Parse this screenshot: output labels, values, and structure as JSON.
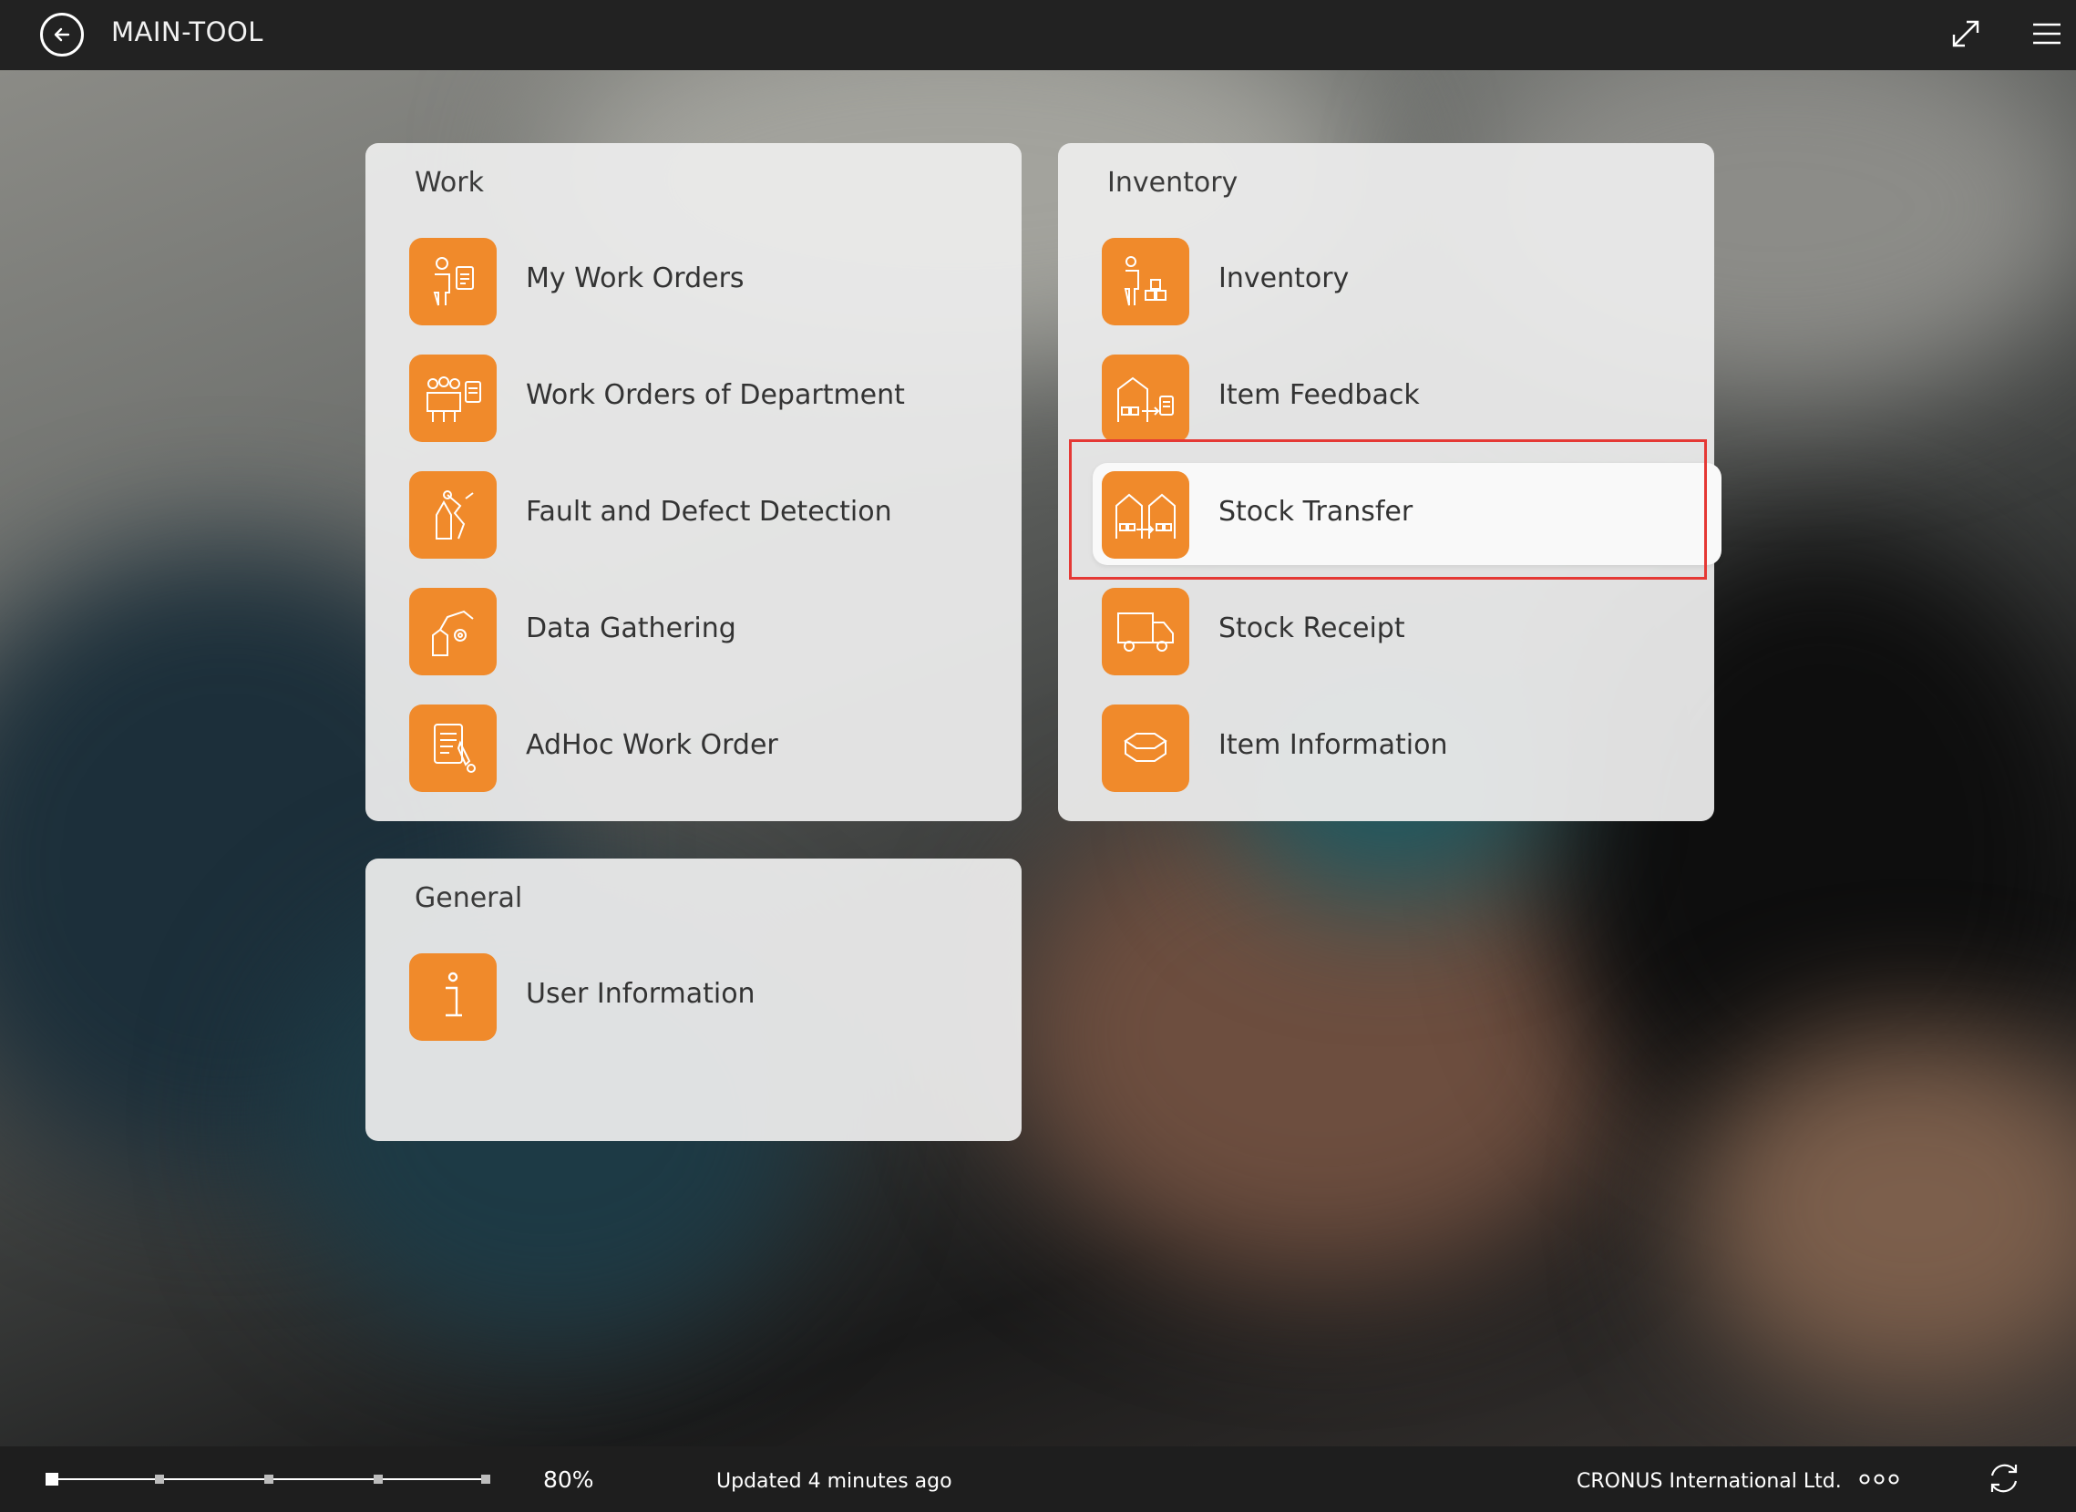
{
  "header": {
    "title": "MAIN-TOOL",
    "back_icon": "back-arrow-circle-icon",
    "expand_icon": "expand-diagonal-icon",
    "menu_icon": "hamburger-menu-icon"
  },
  "colors": {
    "accent": "#f08a2b",
    "topbar": "#222222",
    "highlight": "#e53935"
  },
  "sections": {
    "work": {
      "title": "Work",
      "items": [
        {
          "label": "My Work Orders",
          "icon": "worker-clipboard-icon"
        },
        {
          "label": "Work Orders of Department",
          "icon": "team-clipboard-icon"
        },
        {
          "label": "Fault and Defect Detection",
          "icon": "fault-detection-icon"
        },
        {
          "label": "Data Gathering",
          "icon": "robot-arm-gear-icon"
        },
        {
          "label": "AdHoc Work Order",
          "icon": "document-pen-icon"
        }
      ]
    },
    "inventory": {
      "title": "Inventory",
      "items": [
        {
          "label": "Inventory",
          "icon": "worker-boxes-icon"
        },
        {
          "label": "Item Feedback",
          "icon": "warehouse-feedback-icon"
        },
        {
          "label": "Stock Transfer",
          "icon": "warehouse-transfer-icon",
          "selected": true
        },
        {
          "label": "Stock Receipt",
          "icon": "delivery-truck-icon"
        },
        {
          "label": "Item Information",
          "icon": "box-info-icon"
        }
      ]
    },
    "general": {
      "title": "General",
      "items": [
        {
          "label": "User Information",
          "icon": "info-icon"
        }
      ]
    }
  },
  "footer": {
    "zoom": "80%",
    "zoom_level_fraction": 0.0,
    "status": "Updated 4 minutes ago",
    "company": "CRONUS International Ltd.",
    "more_icon": "more-dots-icon",
    "sync_icon": "sync-icon"
  }
}
